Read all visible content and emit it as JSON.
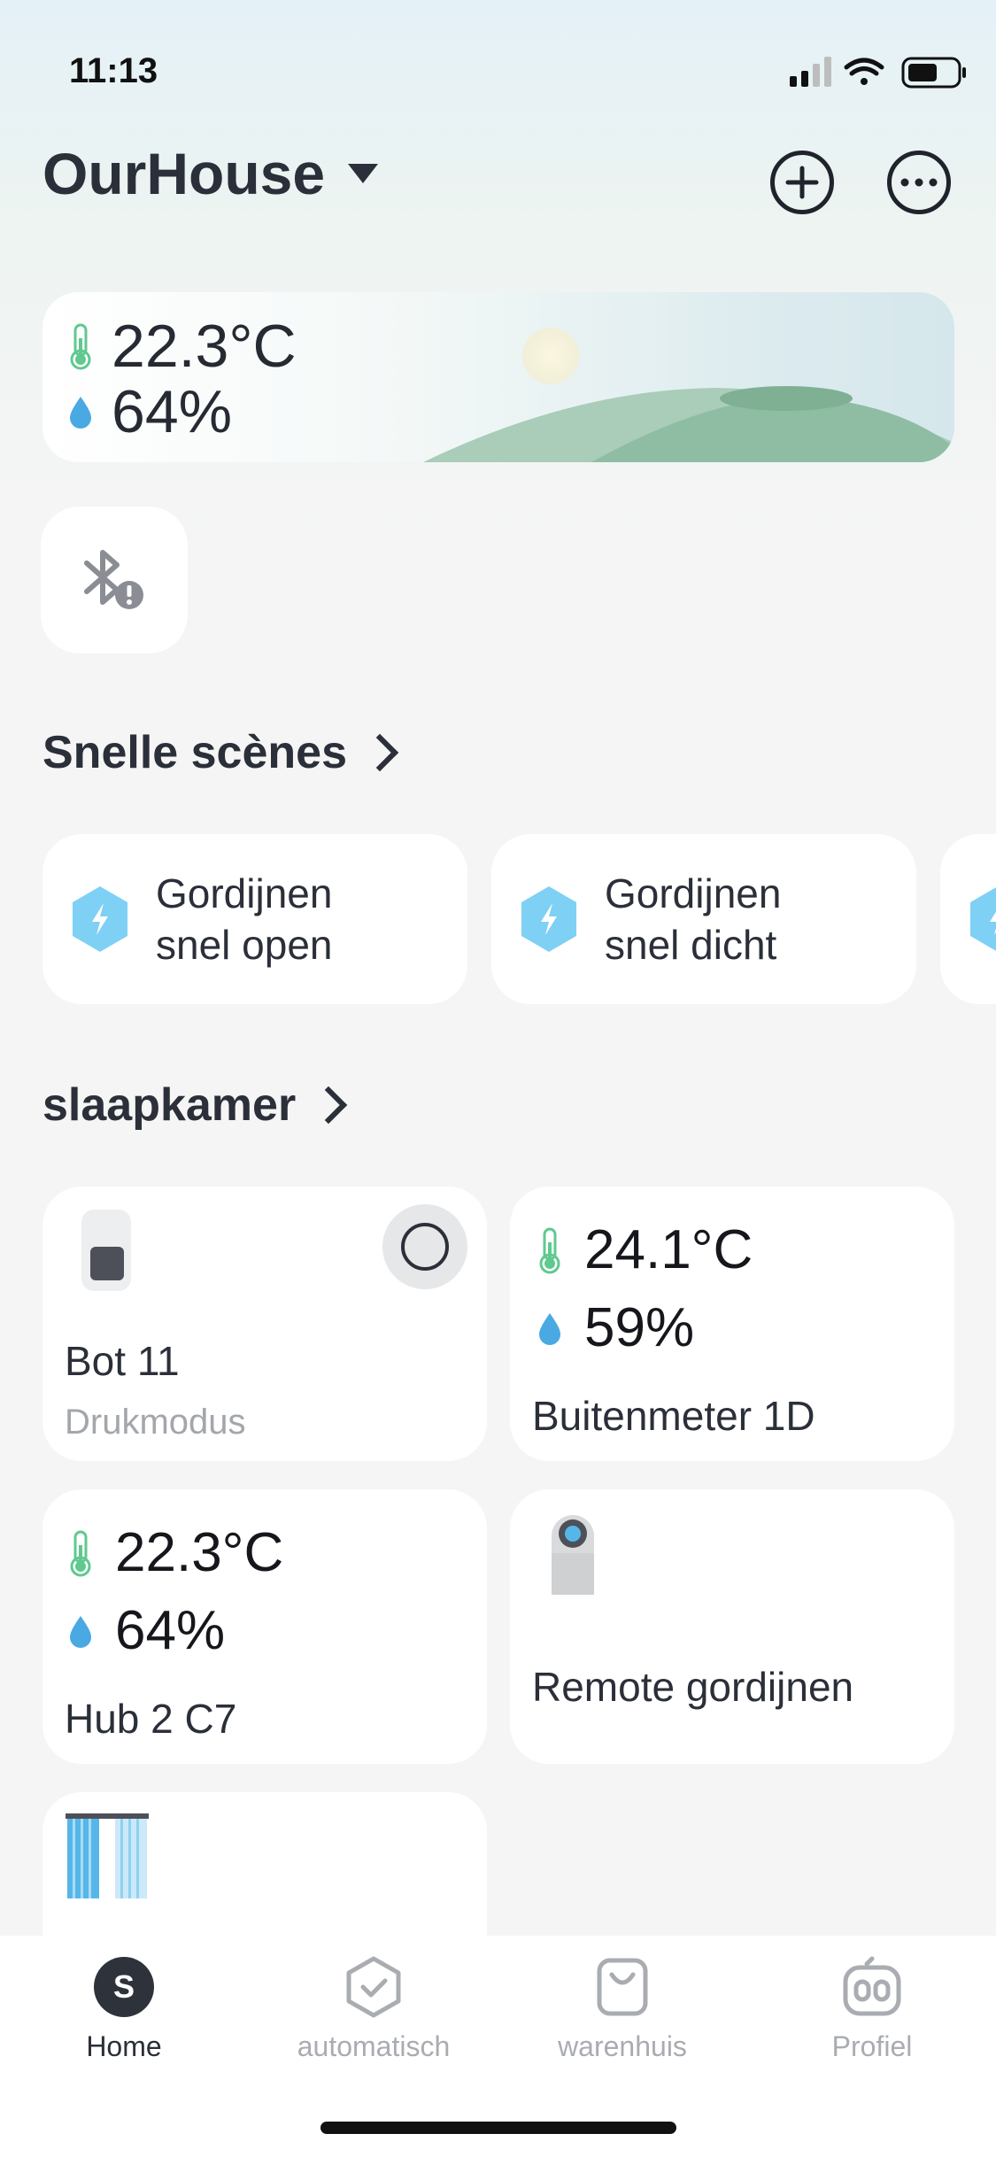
{
  "status_bar": {
    "time": "11:13"
  },
  "header": {
    "home_name": "OurHouse"
  },
  "weather": {
    "temperature": "22.3°C",
    "humidity": "64%"
  },
  "quick_scenes": {
    "title": "Snelle scènes",
    "items": [
      {
        "label_line1": "Gordijnen",
        "label_line2": "snel open"
      },
      {
        "label_line1": "Gordijnen",
        "label_line2": "snel dicht"
      }
    ]
  },
  "room": {
    "title": "slaapkamer",
    "devices": [
      {
        "name": "Bot 11",
        "sub": "Drukmodus"
      },
      {
        "name": "Buitenmeter 1D",
        "temperature": "24.1°C",
        "humidity": "59%"
      },
      {
        "name": "Hub 2 C7",
        "temperature": "22.3°C",
        "humidity": "64%"
      },
      {
        "name": "Remote gordijnen"
      }
    ]
  },
  "tabs": [
    {
      "label": "Home",
      "active": true
    },
    {
      "label": "automatisch"
    },
    {
      "label": "warenhuis"
    },
    {
      "label": "Profiel"
    }
  ],
  "colors": {
    "thermo": "#5fc98f",
    "drop": "#4aa9e3",
    "scene_icon": "#7fd0f5",
    "text_dark": "#2b2f39"
  }
}
